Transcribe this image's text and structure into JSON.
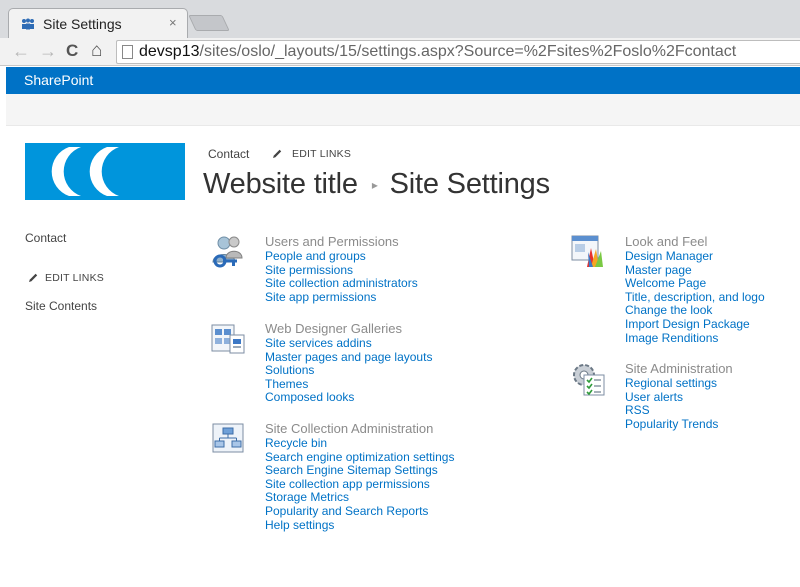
{
  "browser": {
    "tab_title": "Site Settings",
    "close_glyph": "×",
    "back_glyph": "←",
    "forward_glyph": "→",
    "reload_glyph": "C",
    "home_glyph": "⌂",
    "url_host": "devsp13",
    "url_path": "/sites/oslo/_layouts/15/settings.aspx?Source=%2Fsites%2Foslo%2Fcontact"
  },
  "suite_bar": {
    "brand": "SharePoint"
  },
  "header": {
    "top_nav": {
      "contact": "Contact",
      "edit_links": "EDIT LINKS"
    },
    "site_title": "Website title",
    "separator": "▸",
    "page_title": "Site Settings"
  },
  "left_nav": {
    "contact": "Contact",
    "edit_links": "EDIT LINKS",
    "site_contents": "Site Contents"
  },
  "groups": {
    "users": {
      "icon": "users-icon",
      "title": "Users and Permissions",
      "links": [
        "People and groups",
        "Site permissions",
        "Site collection administrators",
        "Site app permissions"
      ]
    },
    "web_designer": {
      "icon": "web-designer-galleries-icon",
      "title": "Web Designer Galleries",
      "links": [
        "Site services addins",
        "Master pages and page layouts",
        "Solutions",
        "Themes",
        "Composed looks"
      ]
    },
    "site_collection": {
      "icon": "site-collection-admin-icon",
      "title": "Site Collection Administration",
      "links": [
        "Recycle bin",
        "Search engine optimization settings",
        "Search Engine Sitemap Settings",
        "Site collection app permissions",
        "Storage Metrics",
        "Popularity and Search Reports",
        "Help settings"
      ]
    },
    "look_feel": {
      "icon": "look-and-feel-icon",
      "title": "Look and Feel",
      "links": [
        "Design Manager",
        "Master page",
        "Welcome Page",
        "Title, description, and logo",
        "Change the look",
        "Import Design Package",
        "Image Renditions"
      ]
    },
    "site_admin": {
      "icon": "site-administration-icon",
      "title": "Site Administration",
      "links": [
        "Regional settings",
        "User alerts",
        "RSS",
        "Popularity Trends"
      ]
    }
  },
  "colors": {
    "suite_bar": "#0072c6",
    "link": "#0072c6",
    "logo": "#0095dc",
    "group_title": "#8b8b8b"
  }
}
